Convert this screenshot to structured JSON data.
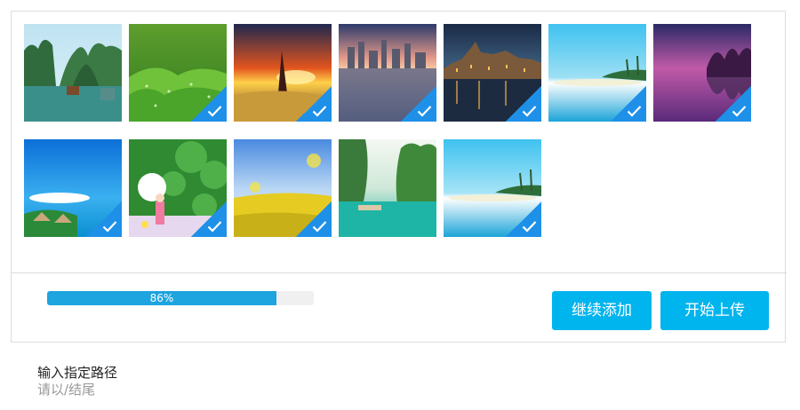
{
  "gallery": {
    "images": [
      {
        "scene": "karst-bay-with-boats",
        "selected": false
      },
      {
        "scene": "green-grass-dew",
        "selected": true
      },
      {
        "scene": "anime-sunset-field",
        "selected": true
      },
      {
        "scene": "city-skyline-sunset-water",
        "selected": true
      },
      {
        "scene": "castle-night-reflection",
        "selected": true
      },
      {
        "scene": "tropical-beach-palms",
        "selected": true
      },
      {
        "scene": "purple-lake-trees",
        "selected": true
      },
      {
        "scene": "blue-sky-island-huts",
        "selected": true
      },
      {
        "scene": "girl-umbrella-green-leaves",
        "selected": true
      },
      {
        "scene": "yellow-flower-field",
        "selected": true
      },
      {
        "scene": "green-cliffs-lagoon-boat",
        "selected": true
      },
      {
        "scene": "tropical-beach-palms-2",
        "selected": true
      }
    ],
    "check_icon": "check-icon",
    "badge_color": "#1e90e8"
  },
  "progress": {
    "fraction": 0.86,
    "label": "86%",
    "fill_color": "#1ea4df"
  },
  "actions": {
    "continue_add_label": "继续添加",
    "start_upload_label": "开始上传",
    "button_color": "#00b4ee"
  },
  "path_input": {
    "label": "输入指定路径",
    "hint": "请以/结尾"
  }
}
